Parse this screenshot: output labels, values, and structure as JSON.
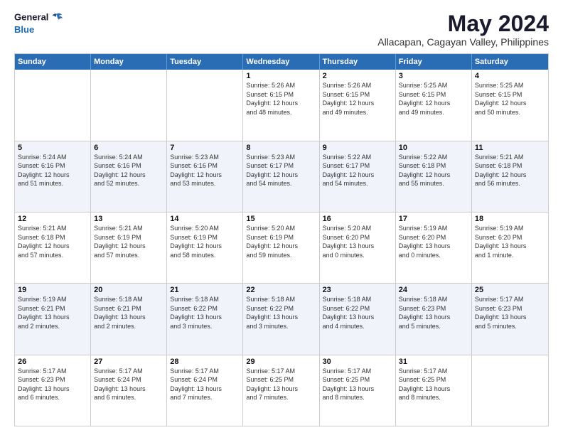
{
  "logo": {
    "line1": "General",
    "line2": "Blue"
  },
  "title": "May 2024",
  "subtitle": "Allacapan, Cagayan Valley, Philippines",
  "header_days": [
    "Sunday",
    "Monday",
    "Tuesday",
    "Wednesday",
    "Thursday",
    "Friday",
    "Saturday"
  ],
  "rows": [
    {
      "alt": false,
      "cells": [
        {
          "day": "",
          "info": ""
        },
        {
          "day": "",
          "info": ""
        },
        {
          "day": "",
          "info": ""
        },
        {
          "day": "1",
          "info": "Sunrise: 5:26 AM\nSunset: 6:15 PM\nDaylight: 12 hours\nand 48 minutes."
        },
        {
          "day": "2",
          "info": "Sunrise: 5:26 AM\nSunset: 6:15 PM\nDaylight: 12 hours\nand 49 minutes."
        },
        {
          "day": "3",
          "info": "Sunrise: 5:25 AM\nSunset: 6:15 PM\nDaylight: 12 hours\nand 49 minutes."
        },
        {
          "day": "4",
          "info": "Sunrise: 5:25 AM\nSunset: 6:15 PM\nDaylight: 12 hours\nand 50 minutes."
        }
      ]
    },
    {
      "alt": true,
      "cells": [
        {
          "day": "5",
          "info": "Sunrise: 5:24 AM\nSunset: 6:16 PM\nDaylight: 12 hours\nand 51 minutes."
        },
        {
          "day": "6",
          "info": "Sunrise: 5:24 AM\nSunset: 6:16 PM\nDaylight: 12 hours\nand 52 minutes."
        },
        {
          "day": "7",
          "info": "Sunrise: 5:23 AM\nSunset: 6:16 PM\nDaylight: 12 hours\nand 53 minutes."
        },
        {
          "day": "8",
          "info": "Sunrise: 5:23 AM\nSunset: 6:17 PM\nDaylight: 12 hours\nand 54 minutes."
        },
        {
          "day": "9",
          "info": "Sunrise: 5:22 AM\nSunset: 6:17 PM\nDaylight: 12 hours\nand 54 minutes."
        },
        {
          "day": "10",
          "info": "Sunrise: 5:22 AM\nSunset: 6:18 PM\nDaylight: 12 hours\nand 55 minutes."
        },
        {
          "day": "11",
          "info": "Sunrise: 5:21 AM\nSunset: 6:18 PM\nDaylight: 12 hours\nand 56 minutes."
        }
      ]
    },
    {
      "alt": false,
      "cells": [
        {
          "day": "12",
          "info": "Sunrise: 5:21 AM\nSunset: 6:18 PM\nDaylight: 12 hours\nand 57 minutes."
        },
        {
          "day": "13",
          "info": "Sunrise: 5:21 AM\nSunset: 6:19 PM\nDaylight: 12 hours\nand 57 minutes."
        },
        {
          "day": "14",
          "info": "Sunrise: 5:20 AM\nSunset: 6:19 PM\nDaylight: 12 hours\nand 58 minutes."
        },
        {
          "day": "15",
          "info": "Sunrise: 5:20 AM\nSunset: 6:19 PM\nDaylight: 12 hours\nand 59 minutes."
        },
        {
          "day": "16",
          "info": "Sunrise: 5:20 AM\nSunset: 6:20 PM\nDaylight: 13 hours\nand 0 minutes."
        },
        {
          "day": "17",
          "info": "Sunrise: 5:19 AM\nSunset: 6:20 PM\nDaylight: 13 hours\nand 0 minutes."
        },
        {
          "day": "18",
          "info": "Sunrise: 5:19 AM\nSunset: 6:20 PM\nDaylight: 13 hours\nand 1 minute."
        }
      ]
    },
    {
      "alt": true,
      "cells": [
        {
          "day": "19",
          "info": "Sunrise: 5:19 AM\nSunset: 6:21 PM\nDaylight: 13 hours\nand 2 minutes."
        },
        {
          "day": "20",
          "info": "Sunrise: 5:18 AM\nSunset: 6:21 PM\nDaylight: 13 hours\nand 2 minutes."
        },
        {
          "day": "21",
          "info": "Sunrise: 5:18 AM\nSunset: 6:22 PM\nDaylight: 13 hours\nand 3 minutes."
        },
        {
          "day": "22",
          "info": "Sunrise: 5:18 AM\nSunset: 6:22 PM\nDaylight: 13 hours\nand 3 minutes."
        },
        {
          "day": "23",
          "info": "Sunrise: 5:18 AM\nSunset: 6:22 PM\nDaylight: 13 hours\nand 4 minutes."
        },
        {
          "day": "24",
          "info": "Sunrise: 5:18 AM\nSunset: 6:23 PM\nDaylight: 13 hours\nand 5 minutes."
        },
        {
          "day": "25",
          "info": "Sunrise: 5:17 AM\nSunset: 6:23 PM\nDaylight: 13 hours\nand 5 minutes."
        }
      ]
    },
    {
      "alt": false,
      "cells": [
        {
          "day": "26",
          "info": "Sunrise: 5:17 AM\nSunset: 6:23 PM\nDaylight: 13 hours\nand 6 minutes."
        },
        {
          "day": "27",
          "info": "Sunrise: 5:17 AM\nSunset: 6:24 PM\nDaylight: 13 hours\nand 6 minutes."
        },
        {
          "day": "28",
          "info": "Sunrise: 5:17 AM\nSunset: 6:24 PM\nDaylight: 13 hours\nand 7 minutes."
        },
        {
          "day": "29",
          "info": "Sunrise: 5:17 AM\nSunset: 6:25 PM\nDaylight: 13 hours\nand 7 minutes."
        },
        {
          "day": "30",
          "info": "Sunrise: 5:17 AM\nSunset: 6:25 PM\nDaylight: 13 hours\nand 8 minutes."
        },
        {
          "day": "31",
          "info": "Sunrise: 5:17 AM\nSunset: 6:25 PM\nDaylight: 13 hours\nand 8 minutes."
        },
        {
          "day": "",
          "info": ""
        }
      ]
    }
  ]
}
